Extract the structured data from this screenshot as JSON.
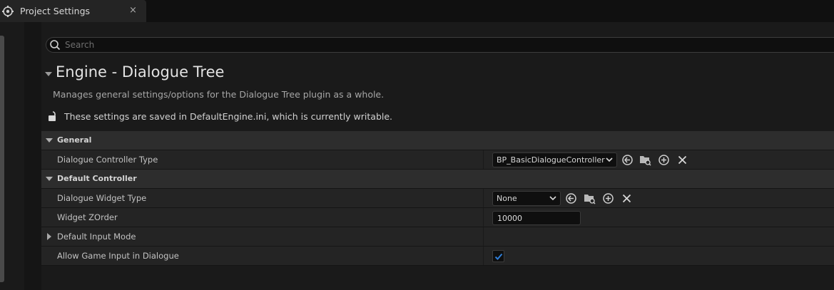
{
  "window": {
    "tab_title": "Project Settings",
    "tab_icon": "unreal-settings-icon",
    "close_glyph": "×"
  },
  "search": {
    "placeholder": "Search",
    "value": ""
  },
  "section": {
    "title": "Engine - Dialogue Tree",
    "description": "Manages general settings/options for the Dialogue Tree plugin as a whole.",
    "save_status": "These settings are saved in DefaultEngine.ini, which is currently writable."
  },
  "categories": {
    "general": {
      "label": "General",
      "dialogue_controller_type": {
        "label": "Dialogue Controller Type",
        "value": "BP_BasicDialogueController"
      }
    },
    "default_controller": {
      "label": "Default Controller",
      "dialogue_widget_type": {
        "label": "Dialogue Widget Type",
        "value": "None"
      },
      "widget_zorder": {
        "label": "Widget ZOrder",
        "value": "10000"
      },
      "default_input_mode": {
        "label": "Default Input Mode"
      },
      "allow_game_input": {
        "label": "Allow Game Input in Dialogue",
        "checked": true
      }
    }
  },
  "colors": {
    "background": "#151515",
    "panel": "#1a1a1a",
    "category_row": "#2d2d2d",
    "property_row": "#242424",
    "accent_check": "#2f7fd9"
  }
}
